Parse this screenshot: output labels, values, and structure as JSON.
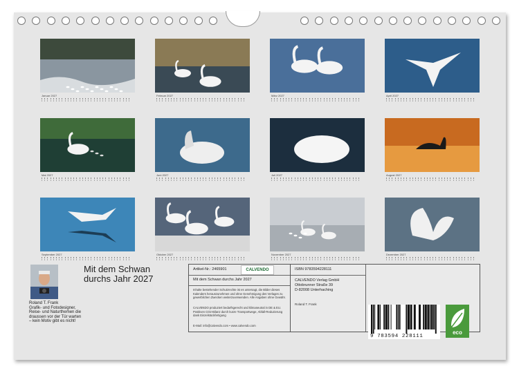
{
  "calendar": {
    "title_line1": "Mit dem Schwan",
    "title_line2": "durchs Jahr 2027",
    "months": [
      {
        "label": "Januar 2027",
        "image": "swans on winter lake"
      },
      {
        "label": "Februar 2027",
        "image": "swans in reeds"
      },
      {
        "label": "März 2027",
        "image": "two swans forming heart"
      },
      {
        "label": "April 2027",
        "image": "swan in flight over water"
      },
      {
        "label": "Mai 2027",
        "image": "swan with cygnets"
      },
      {
        "label": "Juni 2027",
        "image": "young swan on water"
      },
      {
        "label": "Juli 2027",
        "image": "swan with raised wings"
      },
      {
        "label": "August 2027",
        "image": "swan silhouette at sunset"
      },
      {
        "label": "September 2027",
        "image": "swan flying low over blue water"
      },
      {
        "label": "Oktober 2027",
        "image": "swans flapping wings"
      },
      {
        "label": "November 2027",
        "image": "swans in morning mist"
      },
      {
        "label": "Dezember 2027",
        "image": "swan spreading wings"
      }
    ]
  },
  "author": {
    "name": "Roland T. Frank",
    "bio": "Grafik- und Fotodesigner, Reise- und Naturthemen die draussen vor der Tür warten – kein Motiv gibt es nicht!"
  },
  "info": {
    "article_no": "Artikel-Nr.: 2465901",
    "product_title": "Mit dem Schwan durchs Jahr 2027",
    "copyright": "Inhalte bestehender Schutzrechte ist es untersagt, die Bilder dieses Kalenders herauszunehmen und ohne Genehmigung des Verlages zu gewerblichen Zwecken weiterzuverwenden. Alle Angaben ohne Gewähr.",
    "eco_text": "CALVENDO produziert bedarfsgerecht und klimaneutral in DE & EU. Positiven CO2-Bilanz durch kurze Transportwege, Abfall-Reduzierung dank Einzelstückfertigung",
    "contact": "E-Mail: info@calvendo.com • www.calvendo.com",
    "logo": "CALVENDO"
  },
  "publisher": {
    "isbn": "ISBN 9783594228111",
    "name": "CALVENDO Verlag GmbH",
    "street": "Ottobrunner Straße 39",
    "city": "D-82008 Unterhaching",
    "author": "Roland T. Frank"
  },
  "barcode": {
    "number": "9 783594 228111",
    "icon": "barcode-icon"
  },
  "eco_badge": {
    "label": "eco",
    "icon": "leaf-icon",
    "color": "#4a9a3c"
  }
}
